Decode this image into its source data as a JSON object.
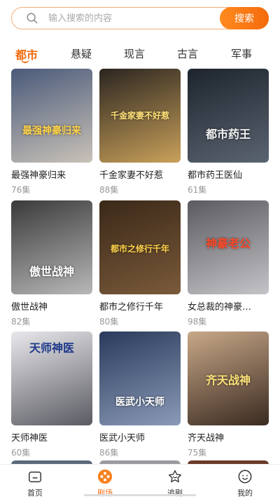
{
  "search": {
    "placeholder": "输入搜索的内容",
    "button": "搜索"
  },
  "tabs": [
    {
      "label": "都市",
      "active": true
    },
    {
      "label": "悬疑",
      "active": false
    },
    {
      "label": "现言",
      "active": false
    },
    {
      "label": "古言",
      "active": false
    },
    {
      "label": "军事",
      "active": false
    }
  ],
  "dramas": [
    {
      "title": "最强神豪归来",
      "episodes": "76集",
      "poster_text": "最强神豪归来",
      "colors": [
        "#4a5a7a",
        "#c9c2b8"
      ]
    },
    {
      "title": "千金家妻不好惹",
      "episodes": "88集",
      "poster_text": "千金家妻不好惹",
      "colors": [
        "#2b2520",
        "#c9a15a"
      ]
    },
    {
      "title": "都市药王医仙",
      "episodes": "61集",
      "poster_text": "都市药王",
      "colors": [
        "#1d242e",
        "#5a6470"
      ]
    },
    {
      "title": "傲世战神",
      "episodes": "82集",
      "poster_text": "傲世战神",
      "colors": [
        "#3a3a3a",
        "#b8b8b8"
      ]
    },
    {
      "title": "都市之修行千年",
      "episodes": "80集",
      "poster_text": "都市之修行千年",
      "colors": [
        "#3a2818",
        "#7a5a3a"
      ]
    },
    {
      "title": "女总裁的神豪…",
      "episodes": "98集",
      "poster_text": "神豪老公",
      "colors": [
        "#5a5a60",
        "#c4c4c8"
      ]
    },
    {
      "title": "天师神医",
      "episodes": "60集",
      "poster_text": "天师神医",
      "colors": [
        "#e8e8ec",
        "#5a5a62"
      ]
    },
    {
      "title": "医武小天师",
      "episodes": "86集",
      "poster_text": "医武小天师",
      "colors": [
        "#2a3a5a",
        "#8a9ab8"
      ]
    },
    {
      "title": "齐天战神",
      "episodes": "75集",
      "poster_text": "齐天战神",
      "colors": [
        "#c8a888",
        "#3a2a20"
      ]
    }
  ],
  "nav": [
    {
      "label": "首页",
      "icon": "home-icon",
      "active": false
    },
    {
      "label": "剧场",
      "icon": "theater-icon",
      "active": true
    },
    {
      "label": "追剧",
      "icon": "star-icon",
      "active": false
    },
    {
      "label": "我的",
      "icon": "profile-icon",
      "active": false
    }
  ],
  "colors": {
    "accent": "#f26d10",
    "search_border": "#f2b07a"
  }
}
